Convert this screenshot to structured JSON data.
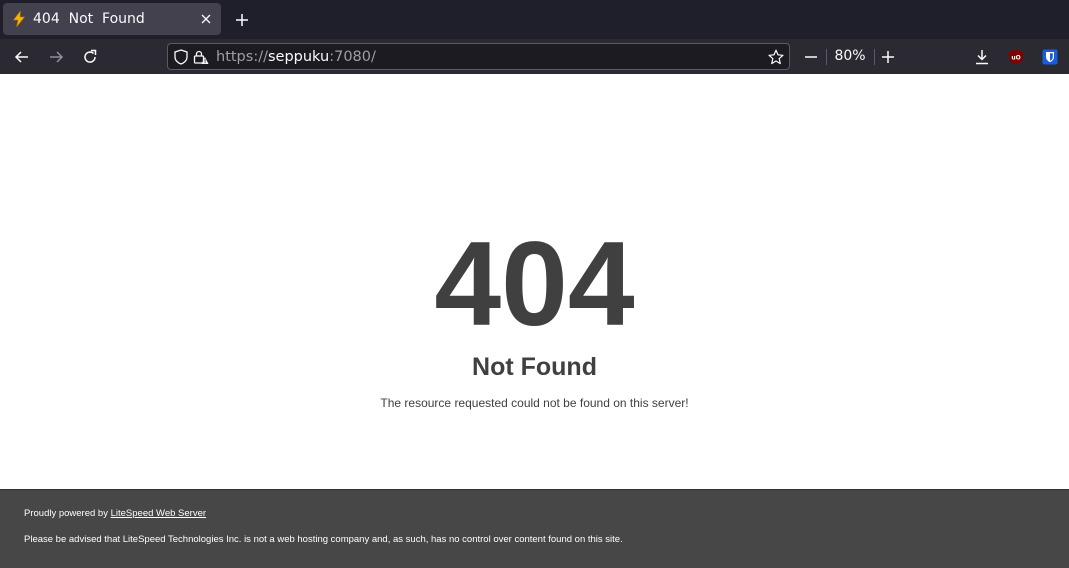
{
  "browser": {
    "tab": {
      "title": "404  Not  Found"
    },
    "url": {
      "scheme": "https://",
      "host": "seppuku",
      "port": ":7080/"
    },
    "zoom": "80%"
  },
  "page": {
    "code": "404",
    "heading": "Not Found",
    "message": "The resource requested could not be found on this server!"
  },
  "footer": {
    "powered_prefix": "Proudly powered by ",
    "powered_link": "LiteSpeed Web Server",
    "disclaimer": "Please be advised that LiteSpeed Technologies Inc. is not a web hosting company and, as such, has no control over content found on this site."
  },
  "colors": {
    "text": "#404040",
    "footer_bg": "#474747",
    "chrome_bg": "#2b2a33",
    "tabbar_bg": "#1f1e2b"
  }
}
